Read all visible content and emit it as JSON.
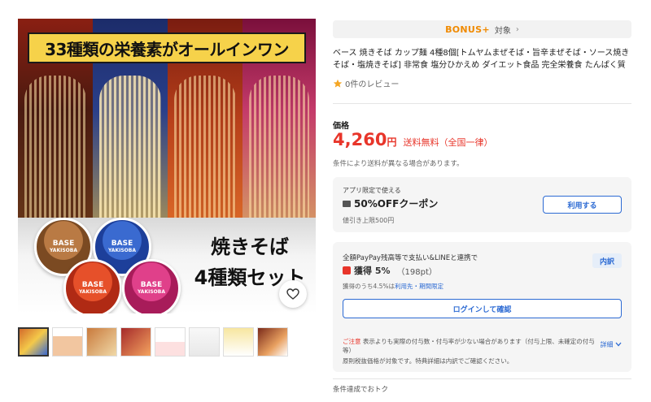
{
  "hero": {
    "banner": "33種類の栄養素がオールインワン",
    "caption_line1": "焼きそば",
    "caption_line2": "4種類セット",
    "cups": [
      {
        "brand": "BASE",
        "sub": "YAKISOBA"
      },
      {
        "brand": "BASE",
        "sub": "YAKISOBA"
      },
      {
        "brand": "BASE",
        "sub": "YAKISOBA"
      },
      {
        "brand": "BASE",
        "sub": "YAKISOBA"
      }
    ]
  },
  "bonus": {
    "logo": "BONUS+",
    "label": "対象",
    "chevron": "›"
  },
  "product": {
    "title": "ベース 焼きそば カップ麺 4種8個[トムヤムまぜそば・旨辛まぜそば・ソース焼きそば・塩焼きそば] 非常食 塩分ひかえめ ダイエット食品 完全栄養食 たんぱく質",
    "review_text": "0件のレビュー"
  },
  "price": {
    "label": "価格",
    "value": "4,260",
    "unit": "円",
    "shipping": "送料無料（全国一律）",
    "shipping_note": "条件により送料が異なる場合があります。"
  },
  "coupon": {
    "tag": "アプリ限定で使える",
    "title": "50%OFFクーポン",
    "limit": "値引き上限500円",
    "button": "利用する"
  },
  "paypay": {
    "heading": "全額PayPay残高等で支払い&LINEと連携で",
    "gain": "獲得 5%",
    "points": "（198pt）",
    "sub_prefix": "獲得のうち4.5%は",
    "sub_link": "利用先・期間限定",
    "breakdown_button": "内訳",
    "login_button": "ログインして確認",
    "notice_warn": "ご注意",
    "notice_text": "表示よりも実際の付与数・付与率が少ない場合があります（付与上限、未確定の付与等）",
    "details_link": "詳細",
    "note2": "原則税抜価格が対象です。特典詳細は内訳でご確認ください。"
  },
  "deals": {
    "label": "条件達成でおトク"
  },
  "colors": {
    "price_red": "#e8352a",
    "link_blue": "#2c6ad3",
    "bonus_orange": "#f08a00",
    "star": "#f5a623"
  }
}
